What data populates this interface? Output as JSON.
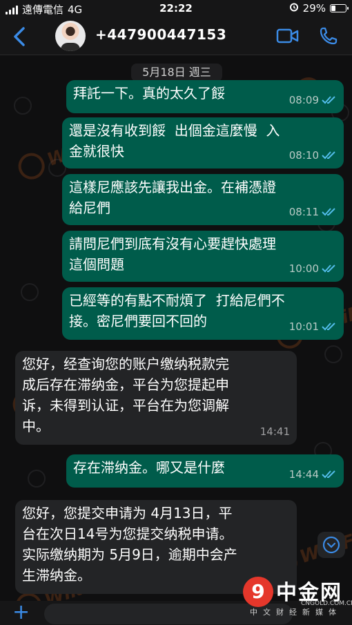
{
  "status_bar": {
    "carrier": "遠傳電信",
    "network": "4G",
    "time": "22:22",
    "battery_percent": "29%",
    "battery_level": 0.29
  },
  "header": {
    "contact_name": "+447900447153"
  },
  "chat": {
    "date_separator": "5月18日 週三",
    "messages": [
      {
        "direction": "out",
        "text": "拜託一下。真的太久了餒",
        "time": "08:09"
      },
      {
        "direction": "out",
        "text": "還是沒有收到餒  出個金這麼慢  入\n金就很快",
        "time": "08:10"
      },
      {
        "direction": "out",
        "text": "這樣尼應該先讓我出金。在補憑證\n給尼們",
        "time": "08:11"
      },
      {
        "direction": "out",
        "text": "請問尼們到底有沒有心要趕快處理\n這個問題",
        "time": "10:00"
      },
      {
        "direction": "out",
        "text": "已經等的有點不耐煩了  打給尼們不\n接。密尼們要回不回的",
        "time": "10:01"
      },
      {
        "direction": "in",
        "text": "您好，经查询您的账户缴纳税款完\n成后存在滞纳金，平台为您提起申\n诉，未得到认证，平台在为您调解\n中。",
        "time": "14:41"
      },
      {
        "direction": "out",
        "text": "存在滞纳金。哪又是什麼",
        "time": "14:44"
      },
      {
        "direction": "in",
        "text": "您好，您提交申请为 4月13日，平\n台在次日14号为您提交纳税申请。\n实际缴纳期为 5月9日，逾期中会产\n生滞纳金。",
        "time": ""
      }
    ]
  },
  "watermark": {
    "text": "WikiFX"
  },
  "brand": {
    "logo_glyph": "9",
    "title": "中金网",
    "domain": "CNGOLD.COM.CN",
    "tagline": "中文财经新媒体"
  },
  "composer": {
    "plus_label": "+"
  },
  "colors": {
    "outgoing_bubble": "#005c4b",
    "incoming_bubble": "#232426",
    "accent": "#3b8be6",
    "read_ticks": "#53bdeb"
  }
}
